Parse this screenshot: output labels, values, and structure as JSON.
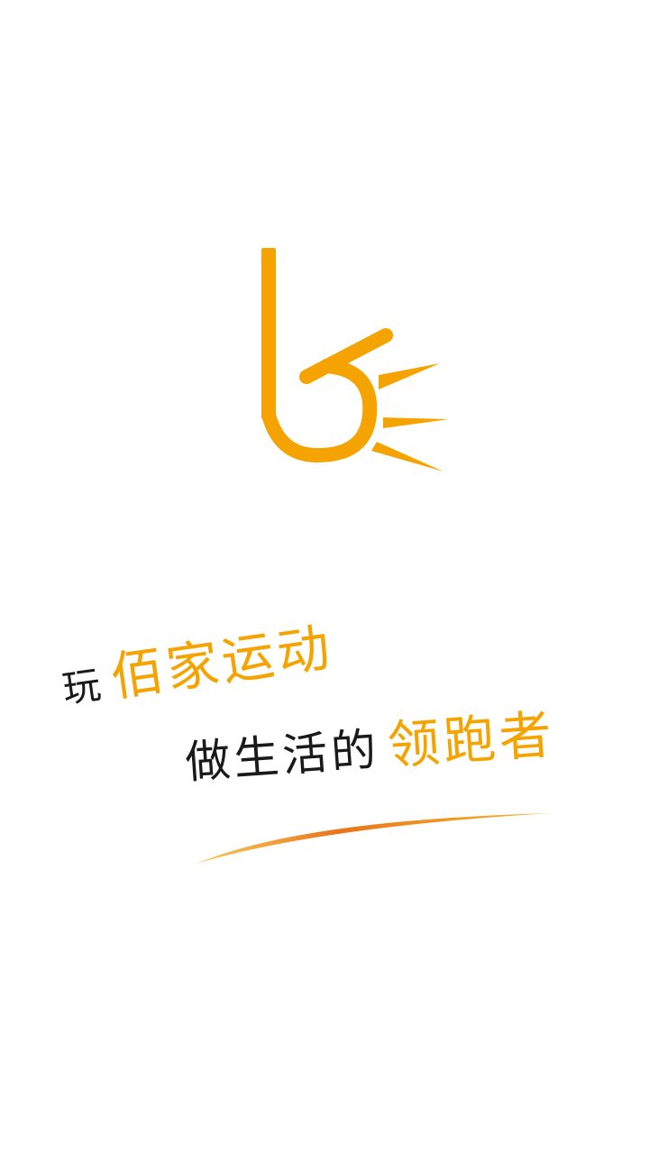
{
  "splash": {
    "logo": {
      "icon": "baijia-b-logo-icon",
      "color": "#f5a300"
    },
    "slogan": {
      "line1": {
        "prefix": "玩",
        "highlight": "佰家运动"
      },
      "line2": {
        "prefix": "做生活的",
        "highlight": "领跑者"
      }
    },
    "colors": {
      "accent": "#f5a300",
      "text": "#1a1a1a",
      "background": "#ffffff"
    }
  }
}
